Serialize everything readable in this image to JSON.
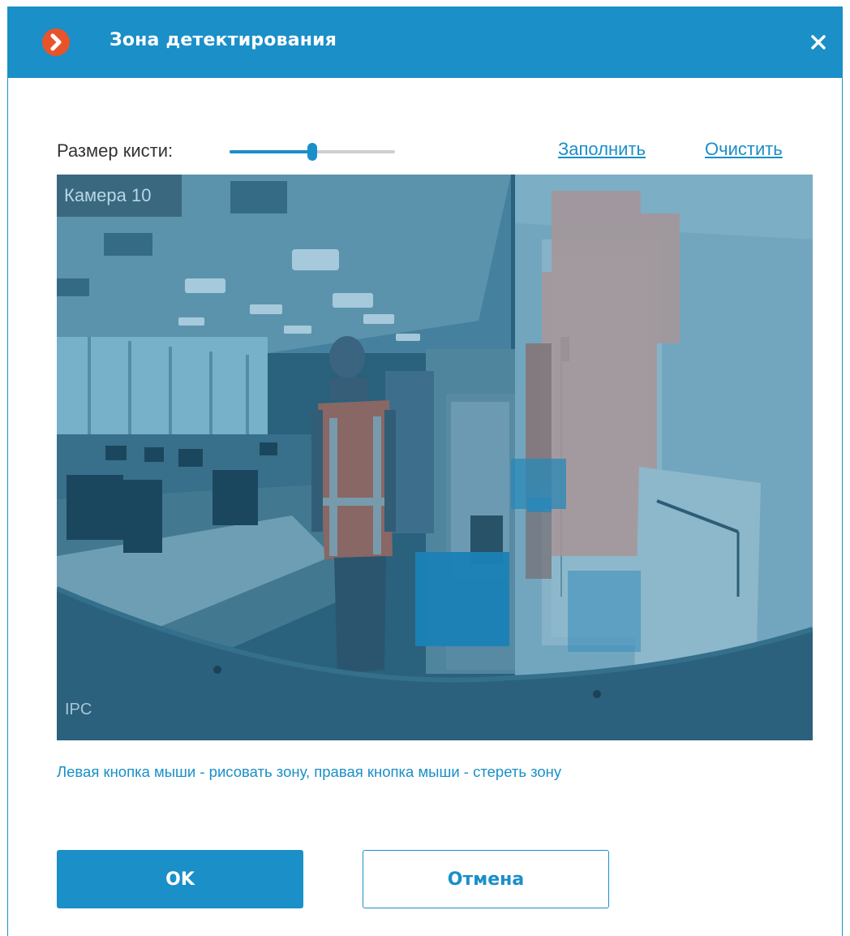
{
  "dialog": {
    "title": "Зона детектирования",
    "accent_color": "#1a8fc8",
    "logo_color": "#e8542a"
  },
  "brush": {
    "label": "Размер кисти:",
    "value_fraction": 0.5
  },
  "actions": {
    "fill_label": "Заполнить",
    "clear_label": "Очистить"
  },
  "video": {
    "camera_name": "Камера 10",
    "watermark": "IPC"
  },
  "hint": "Левая кнопка мыши - рисовать зону, правая кнопка мыши - стереть зону",
  "buttons": {
    "ok_label": "OK",
    "cancel_label": "Отмена"
  }
}
